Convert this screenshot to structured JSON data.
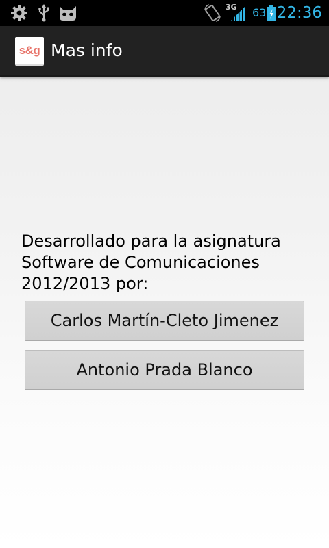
{
  "status_bar": {
    "icons": [
      "settings-icon",
      "usb-icon",
      "android-cat-icon",
      "rotation-icon",
      "signal-3g-icon",
      "battery-icon"
    ],
    "network_type": "3G",
    "battery_level": "63",
    "clock": "22:36",
    "accent_color": "#33b5e5"
  },
  "action_bar": {
    "logo_text": "s&g",
    "title": "Mas info"
  },
  "content": {
    "description_lines": [
      "Desarrollado para la asignatura",
      "Software de Comunicaciones",
      "2012/2013 por:"
    ],
    "buttons": [
      {
        "label": "Carlos Martín-Cleto Jimenez"
      },
      {
        "label": "Antonio Prada Blanco"
      }
    ]
  }
}
